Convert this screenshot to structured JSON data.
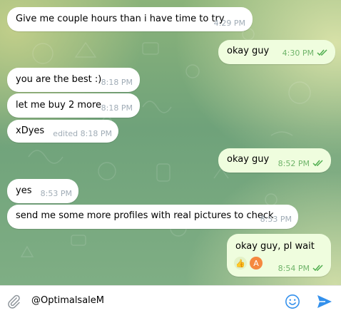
{
  "messages": [
    {
      "text": "Give me couple hours than i have time to try",
      "time": "4:29 PM",
      "direction": "in"
    },
    {
      "text": "okay guy",
      "time": "4:30 PM",
      "direction": "out",
      "read": true
    },
    {
      "text": "you are the best :)",
      "time": "8:18 PM",
      "direction": "in"
    },
    {
      "text": "let me buy 2 more",
      "time": "8:18 PM",
      "direction": "in"
    },
    {
      "text": "xDyes",
      "time": "edited 8:18 PM",
      "direction": "in"
    },
    {
      "text": "okay guy",
      "time": "8:52 PM",
      "direction": "out",
      "read": true
    },
    {
      "text": "yes",
      "time": "8:53 PM",
      "direction": "in"
    },
    {
      "text": "send me some more profiles with real pictures to check",
      "time": "8:53 PM",
      "direction": "in"
    },
    {
      "text": "okay guy, pl wait",
      "time": "8:54 PM",
      "direction": "out",
      "read": true,
      "reactions": [
        {
          "icon": "thumbs-up-icon",
          "emoji": "👍"
        },
        {
          "icon": "avatar-icon",
          "initial": "A"
        }
      ]
    }
  ],
  "composer": {
    "value": "@OptimalsaleM"
  },
  "colors": {
    "outgoing_bubble": "#effdde",
    "incoming_bubble": "#ffffff",
    "read_ticks": "#4fae4e",
    "send_icon": "#3390ec",
    "emoji_icon": "#3390ec",
    "attach_icon": "#8e959b"
  }
}
